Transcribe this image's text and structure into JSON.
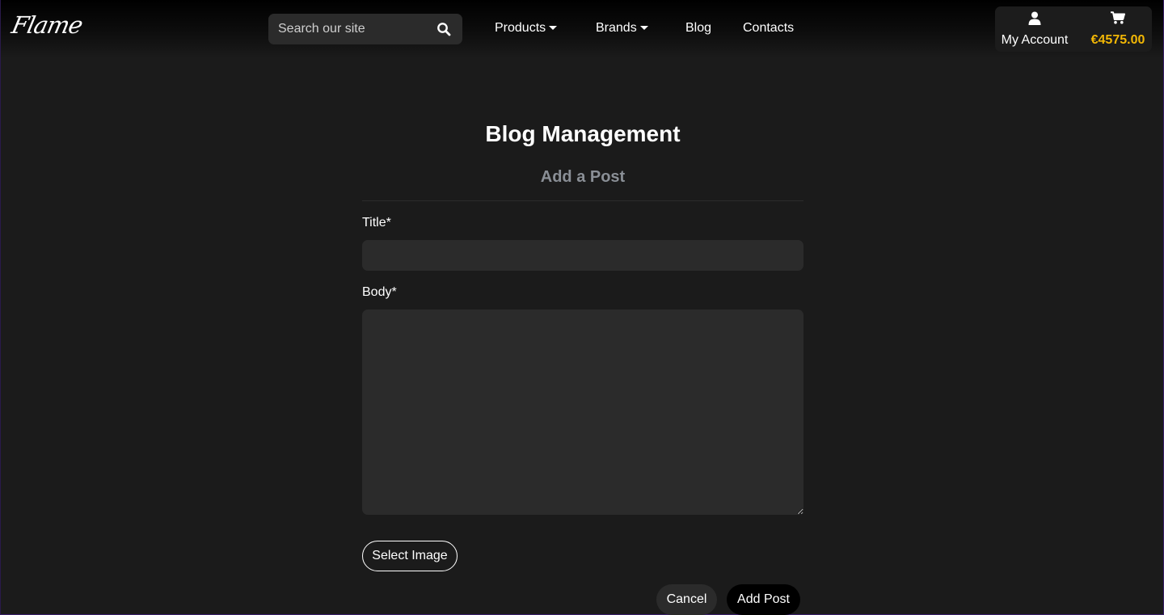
{
  "header": {
    "logo_text": "Flame",
    "search": {
      "placeholder": "Search our site",
      "value": ""
    },
    "nav": {
      "products": "Products",
      "brands": "Brands",
      "blog": "Blog",
      "contacts": "Contacts"
    },
    "account": {
      "label": "My Account",
      "icon": "user-icon"
    },
    "cart": {
      "total": "€4575.00",
      "icon": "cart-icon",
      "total_color": "#f2b705"
    }
  },
  "main": {
    "title": "Blog Management",
    "subtitle": "Add a Post",
    "form": {
      "title_label": "Title*",
      "title_value": "",
      "body_label": "Body*",
      "body_value": "",
      "select_image_label": "Select Image",
      "cancel_label": "Cancel",
      "submit_label": "Add Post"
    }
  }
}
